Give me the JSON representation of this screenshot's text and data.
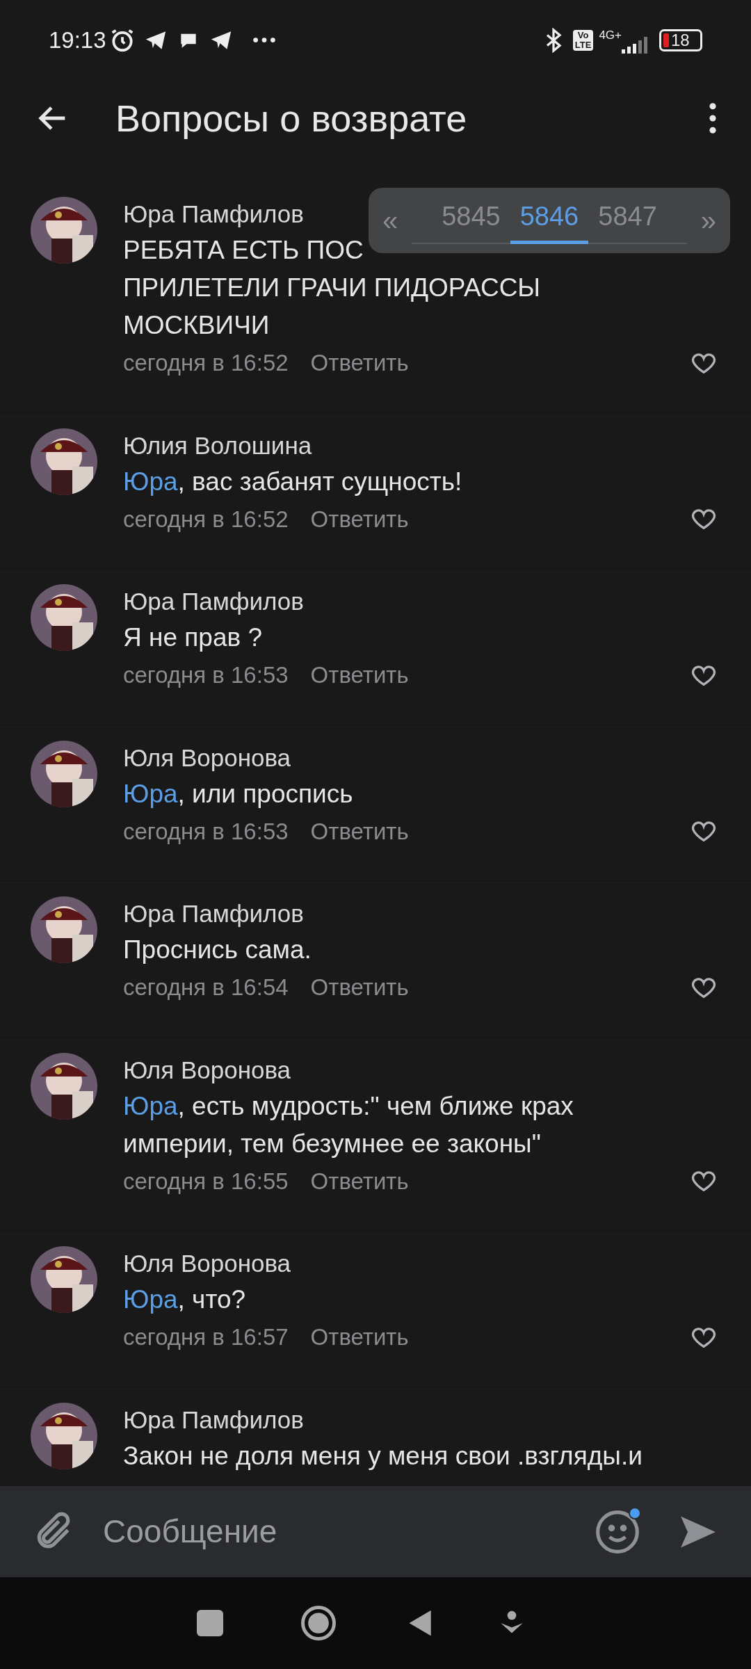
{
  "status_bar": {
    "time": "19:13",
    "network": "4G+",
    "volte": [
      "Vo",
      "LTE"
    ],
    "battery": "18"
  },
  "header": {
    "title": "Вопросы о возврате"
  },
  "pagination": {
    "prev": "«",
    "next": "»",
    "pages": [
      {
        "label": "5845",
        "selected": false
      },
      {
        "label": "5846",
        "selected": true
      },
      {
        "label": "5847",
        "selected": false
      }
    ]
  },
  "comments": [
    {
      "author": "Юра Памфилов",
      "lines": [
        "РЕБЯТА ЕСТЬ ПОС",
        "ПРИЛЕТЕЛИ ГРАЧИ ПИДОРАССЫ",
        "МОСКВИЧИ"
      ],
      "time": "сегодня в 16:52",
      "reply": "Ответить",
      "liked": false
    },
    {
      "author": "Юлия Волошина",
      "mention": "Юра",
      "lines": [
        ", вас забанят сущность!"
      ],
      "time": "сегодня в 16:52",
      "reply": "Ответить",
      "liked": false
    },
    {
      "author": "Юра Памфилов",
      "lines": [
        "Я не прав ?"
      ],
      "time": "сегодня в 16:53",
      "reply": "Ответить",
      "liked": false
    },
    {
      "author": "Юля Воронова",
      "mention": "Юра",
      "lines": [
        ", или проспись"
      ],
      "time": "сегодня в 16:53",
      "reply": "Ответить",
      "liked": false
    },
    {
      "author": "Юра Памфилов",
      "lines": [
        "Проснись сама."
      ],
      "time": "сегодня в 16:54",
      "reply": "Ответить",
      "liked": false
    },
    {
      "author": "Юля Воронова",
      "mention": "Юра",
      "lines": [
        ", есть мудрость:\" чем ближе крах",
        "империи, тем безумнее ее законы\""
      ],
      "time": "сегодня в 16:55",
      "reply": "Ответить",
      "liked": false
    },
    {
      "author": "Юля Воронова",
      "mention": "Юра",
      "lines": [
        ", что?"
      ],
      "time": "сегодня в 16:57",
      "reply": "Ответить",
      "liked": false
    },
    {
      "author": "Юра Памфилов",
      "lines": [
        "Закон не доля меня у меня свои .взгляды.и"
      ]
    }
  ],
  "composer": {
    "placeholder": "Сообщение",
    "emoji_badge": true
  }
}
